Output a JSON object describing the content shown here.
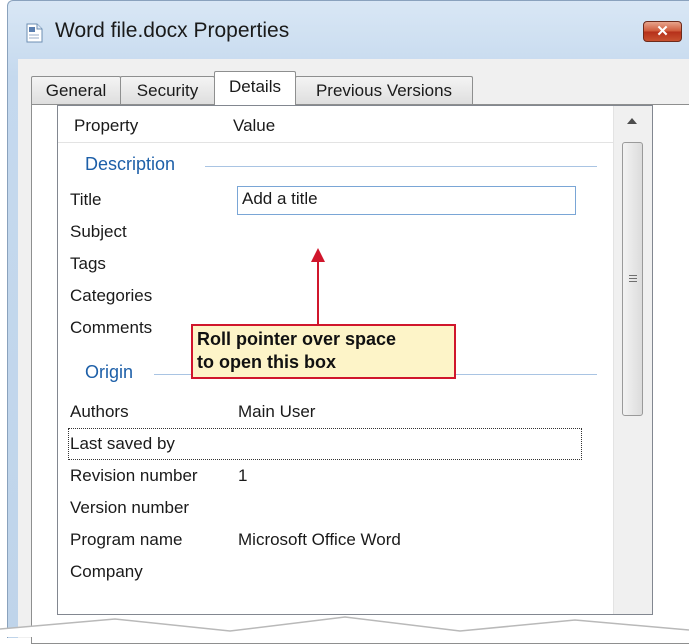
{
  "window": {
    "title": "Word file.docx Properties",
    "close_glyph": "✕"
  },
  "tabs": [
    {
      "label": "General"
    },
    {
      "label": "Security"
    },
    {
      "label": "Details"
    },
    {
      "label": "Previous Versions"
    }
  ],
  "active_tab": "Details",
  "columns": {
    "property": "Property",
    "value": "Value"
  },
  "groups": {
    "description": "Description",
    "origin": "Origin"
  },
  "rows": {
    "title": {
      "label": "Title",
      "value": "Add a title"
    },
    "subject": {
      "label": "Subject",
      "value": ""
    },
    "tags": {
      "label": "Tags",
      "value": ""
    },
    "categories": {
      "label": "Categories",
      "value": ""
    },
    "comments": {
      "label": "Comments",
      "value": ""
    },
    "authors": {
      "label": "Authors",
      "value": "Main User"
    },
    "last_saved_by": {
      "label": "Last saved by",
      "value": ""
    },
    "revision_number": {
      "label": "Revision number",
      "value": "1"
    },
    "version_number": {
      "label": "Version number",
      "value": ""
    },
    "program_name": {
      "label": "Program name",
      "value": "Microsoft Office Word"
    },
    "company": {
      "label": "Company",
      "value": ""
    }
  },
  "callout": {
    "line1": "Roll pointer over space",
    "line2": "to open this box"
  },
  "colors": {
    "group_text": "#1d5fa8",
    "callout_border": "#d0162c",
    "callout_fill": "#fdf4c8"
  }
}
